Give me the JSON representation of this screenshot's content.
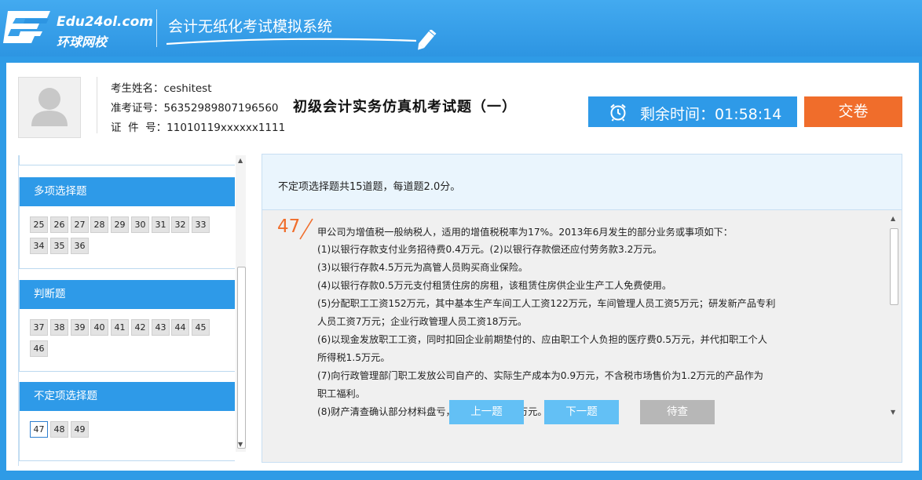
{
  "header": {
    "logo_en": "Edu24ol.com",
    "logo_cn": "环球网校",
    "system_title": "会计无纸化考试模拟系统"
  },
  "candidate": {
    "name_label": "考生姓名：",
    "name": "ceshitest",
    "ticket_label": "准考证号：",
    "ticket": "56352989807196560",
    "id_label": "证  件  号：",
    "id": "11010119xxxxxx1111"
  },
  "exam": {
    "title": "初级会计实务仿真机考试题（一）",
    "timer_label": "剩余时间：",
    "timer_value": "01:58:14",
    "submit_label": "交卷"
  },
  "sections": [
    {
      "title": "多项选择题",
      "numbers": [
        "25",
        "26",
        "27",
        "28",
        "29",
        "30",
        "31",
        "32",
        "33",
        "34",
        "35",
        "36"
      ]
    },
    {
      "title": "判断题",
      "numbers": [
        "37",
        "38",
        "39",
        "40",
        "41",
        "42",
        "43",
        "44",
        "45",
        "46"
      ]
    },
    {
      "title": "不定项选择题",
      "numbers": [
        "47",
        "48",
        "49"
      ],
      "current": "47"
    }
  ],
  "question": {
    "notice": "不定项选择题共15道题，每道题2.0分。",
    "number": "47",
    "lines": [
      "甲公司为增值税一般纳税人，适用的增值税税率为17%。2013年6月发生的部分业务或事项如下：",
      "(1)以银行存款支付业务招待费0.4万元。(2)以银行存款偿还应付劳务款3.2万元。",
      "(3)以银行存款4.5万元为高管人员购买商业保险。",
      "(4)以银行存款0.5万元支付租赁住房的房租，该租赁住房供企业生产工人免费使用。",
      "(5)分配职工工资152万元，其中基本生产车间工人工资122万元，车间管理人员工资5万元；研发新产品专利",
      "人员工资7万元；企业行政管理人员工资18万元。",
      "(6)以现金发放职工工资，同时扣回企业前期垫付的、应由职工个人负担的医疗费0.5万元，并代扣职工个人",
      "所得税1.5万元。",
      "(7)向行政管理部门职工发放公司自产的、实际生产成本为0.9万元，不含税市场售价为1.2万元的产品作为",
      "职工福利。",
      "(8)财产清查确认部分材料盘亏，实际成本为0.4万元。"
    ]
  },
  "nav": {
    "prev_label": "上一题",
    "next_label": "下一题",
    "review_label": "待查"
  },
  "colors": {
    "primary_blue": "#2e9ae8",
    "submit_orange": "#f06d2b",
    "nav_blue": "#63c0f5",
    "review_gray": "#b7b7b7"
  }
}
